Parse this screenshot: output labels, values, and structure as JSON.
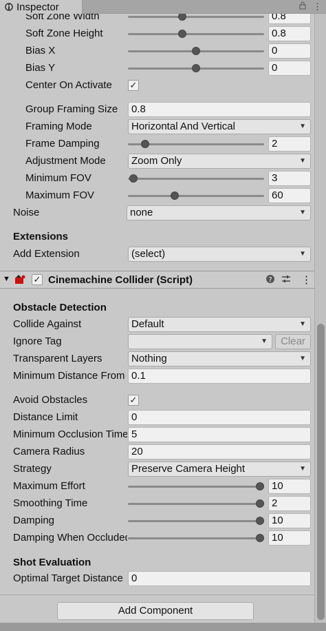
{
  "window": {
    "tab_title": "Inspector"
  },
  "composer": {
    "soft_zone_width": {
      "label": "Soft Zone Width",
      "value": "0.8",
      "slider": 0.5
    },
    "soft_zone_height": {
      "label": "Soft Zone Height",
      "value": "0.8",
      "slider": 0.4
    },
    "bias_x": {
      "label": "Bias X",
      "value": "0",
      "slider": 0.5
    },
    "bias_y": {
      "label": "Bias Y",
      "value": "0",
      "slider": 0.5
    },
    "center_on_activate": {
      "label": "Center On Activate",
      "checked": true
    },
    "group_framing_size": {
      "label": "Group Framing Size",
      "value": "0.8"
    },
    "framing_mode": {
      "label": "Framing Mode",
      "value": "Horizontal And Vertical"
    },
    "frame_damping": {
      "label": "Frame Damping",
      "value": "2",
      "slider": 0.1
    },
    "adjustment_mode": {
      "label": "Adjustment Mode",
      "value": "Zoom Only"
    },
    "minimum_fov": {
      "label": "Minimum FOV",
      "value": "3",
      "slider": 0.02
    },
    "maximum_fov": {
      "label": "Maximum FOV",
      "value": "60",
      "slider": 0.35
    }
  },
  "noise": {
    "label": "Noise",
    "value": "none"
  },
  "extensions": {
    "heading": "Extensions",
    "add_label": "Add Extension",
    "add_value": "(select)"
  },
  "collider": {
    "title": "Cinemachine Collider (Script)",
    "enabled": true,
    "obstacle_heading": "Obstacle Detection",
    "collide_against": {
      "label": "Collide Against",
      "value": "Default"
    },
    "ignore_tag": {
      "label": "Ignore Tag",
      "value": "",
      "clear_label": "Clear"
    },
    "transparent_layers": {
      "label": "Transparent Layers",
      "value": "Nothing"
    },
    "minimum_distance": {
      "label": "Minimum Distance From Target",
      "value": "0.1"
    },
    "avoid_obstacles": {
      "label": "Avoid Obstacles",
      "checked": true
    },
    "distance_limit": {
      "label": "Distance Limit",
      "value": "0"
    },
    "minimum_occlusion_time": {
      "label": "Minimum Occlusion Time",
      "value": "5"
    },
    "camera_radius": {
      "label": "Camera Radius",
      "value": "20"
    },
    "strategy": {
      "label": "Strategy",
      "value": "Preserve Camera Height"
    },
    "maximum_effort": {
      "label": "Maximum Effort",
      "value": "10",
      "slider": 1.0
    },
    "smoothing_time": {
      "label": "Smoothing Time",
      "value": "2",
      "slider": 1.0
    },
    "damping": {
      "label": "Damping",
      "value": "10",
      "slider": 1.0
    },
    "damping_when_occluded": {
      "label": "Damping When Occluded",
      "value": "10",
      "slider": 1.0
    },
    "shot_heading": "Shot Evaluation",
    "optimal_target_distance": {
      "label": "Optimal Target Distance",
      "value": "0"
    }
  },
  "add_component_label": "Add Component",
  "icons": {
    "tab": "inspector-icon",
    "lock": "lock-icon",
    "menu": "kebab-menu-icon",
    "foldout": "foldout-arrow-icon",
    "component": "cinemachine-collider-icon",
    "help": "help-icon",
    "presets": "presets-icon",
    "component_menu": "kebab-menu-icon"
  }
}
